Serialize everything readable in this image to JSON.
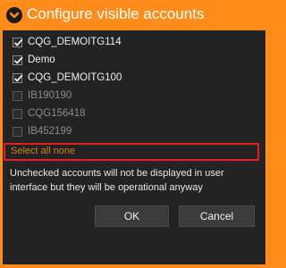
{
  "window": {
    "title": "Configure visible accounts",
    "title_icon": "orange-circle-chevron-icon"
  },
  "accounts": [
    {
      "label": "CQG_DEMOITG114",
      "checked": true
    },
    {
      "label": "Demo",
      "checked": true
    },
    {
      "label": "CQG_DEMOITG100",
      "checked": true
    },
    {
      "label": "IB190190",
      "checked": false
    },
    {
      "label": "CQG156418",
      "checked": false
    },
    {
      "label": "IB452199",
      "checked": false
    }
  ],
  "select_links": "Select all none",
  "note": "Unchecked accounts will not be displayed in user interface but they will be operational anyway",
  "buttons": {
    "ok": "OK",
    "cancel": "Cancel"
  },
  "colors": {
    "accent": "#ff8c1a",
    "panel": "#232323",
    "highlight_border": "#e31e1e",
    "link": "#d47f19"
  }
}
